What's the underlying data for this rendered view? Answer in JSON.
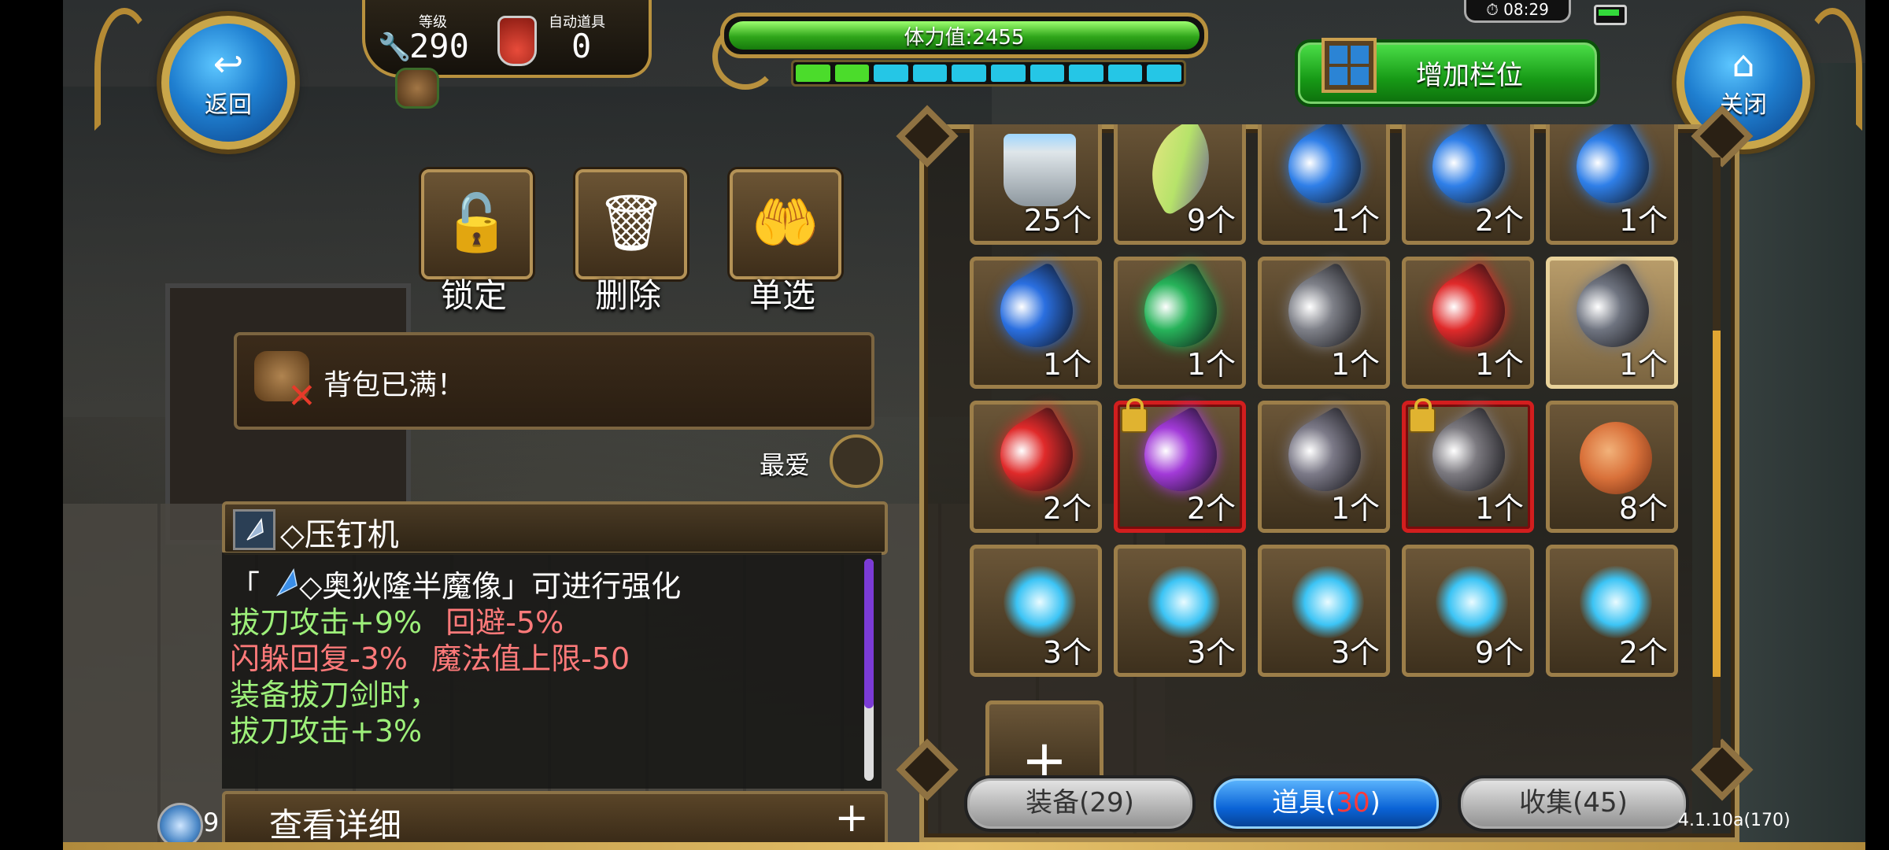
{
  "nav": {
    "back_label": "返回",
    "close_label": "关闭"
  },
  "status": {
    "level_label": "等级",
    "level_value": "290",
    "auto_item_label": "自动道具",
    "auto_item_value": "0"
  },
  "stamina": {
    "label": "体力值:2455",
    "fill_fraction": 1.0,
    "segments": [
      "#4bdc2b",
      "#4bdc2b",
      "#25c6e6",
      "#25c6e6",
      "#25c6e6",
      "#25c6e6",
      "#25c6e6",
      "#25c6e6",
      "#25c6e6",
      "#25c6e6"
    ]
  },
  "clock": "08:29",
  "add_slot_label": "增加栏位",
  "actions": [
    {
      "id": "lock",
      "label": "锁定",
      "icon": "padlock-icon"
    },
    {
      "id": "delete",
      "label": "删除",
      "icon": "trash-icon"
    },
    {
      "id": "single",
      "label": "单选",
      "icon": "hand-pick-icon"
    }
  ],
  "message": "背包已满！",
  "favorite_label": "最爱",
  "item": {
    "name": "◇压钉机",
    "lines": [
      "「 　◇奥狄隆半魔像」可进行强化",
      "拔刀攻击+9%",
      "回避-5%",
      "闪躲回复-3%",
      "魔法值上限-50",
      "装备拔刀剑时，",
      "拔刀攻击+3%"
    ]
  },
  "detail_label": "查看详细",
  "orb_count": "9",
  "inventory": {
    "slots": [
      {
        "kind": "bucket",
        "count": "25个",
        "color": "#bfc8cf"
      },
      {
        "kind": "blade",
        "count": "9个",
        "color": "#b6e36a"
      },
      {
        "kind": "gem",
        "count": "1个",
        "color": "#2f7fe8"
      },
      {
        "kind": "gem",
        "count": "2个",
        "color": "#2f7fe8"
      },
      {
        "kind": "gem",
        "count": "1个",
        "color": "#2f7fe8"
      },
      {
        "kind": "gem",
        "count": "1个",
        "color": "#2a6fe0"
      },
      {
        "kind": "gem",
        "count": "1个",
        "color": "#27b35a"
      },
      {
        "kind": "gem",
        "count": "1个",
        "color": "#7e8088"
      },
      {
        "kind": "gem",
        "count": "1个",
        "color": "#e02a2a"
      },
      {
        "kind": "gem",
        "count": "1个",
        "color": "#6f7480",
        "selected": true
      },
      {
        "kind": "gem",
        "count": "2个",
        "color": "#e02a2a"
      },
      {
        "kind": "gem",
        "count": "2个",
        "color": "#a23ad8",
        "locked": true
      },
      {
        "kind": "gem",
        "count": "1个",
        "color": "#7c7a88"
      },
      {
        "kind": "gem",
        "count": "1个",
        "color": "#7c7a80",
        "locked": true
      },
      {
        "kind": "food",
        "count": "8个",
        "color": "#d9713a"
      },
      {
        "kind": "crystal",
        "count": "3个",
        "color": "#3cc4f5"
      },
      {
        "kind": "crystal",
        "count": "3个",
        "color": "#3cc4f5"
      },
      {
        "kind": "crystal",
        "count": "3个",
        "color": "#3cc4f5"
      },
      {
        "kind": "crystal",
        "count": "9个",
        "color": "#3cc4f5"
      },
      {
        "kind": "crystal",
        "count": "2个",
        "color": "#3cc4f5"
      }
    ],
    "add_symbol": "+"
  },
  "tabs": [
    {
      "label": "装备(29)",
      "active": false
    },
    {
      "label_pre": "道具(",
      "label_num": "30",
      "label_post": ")",
      "active": true
    },
    {
      "label": "收集(45)",
      "active": false
    }
  ],
  "version": "4.1.10a(170)"
}
